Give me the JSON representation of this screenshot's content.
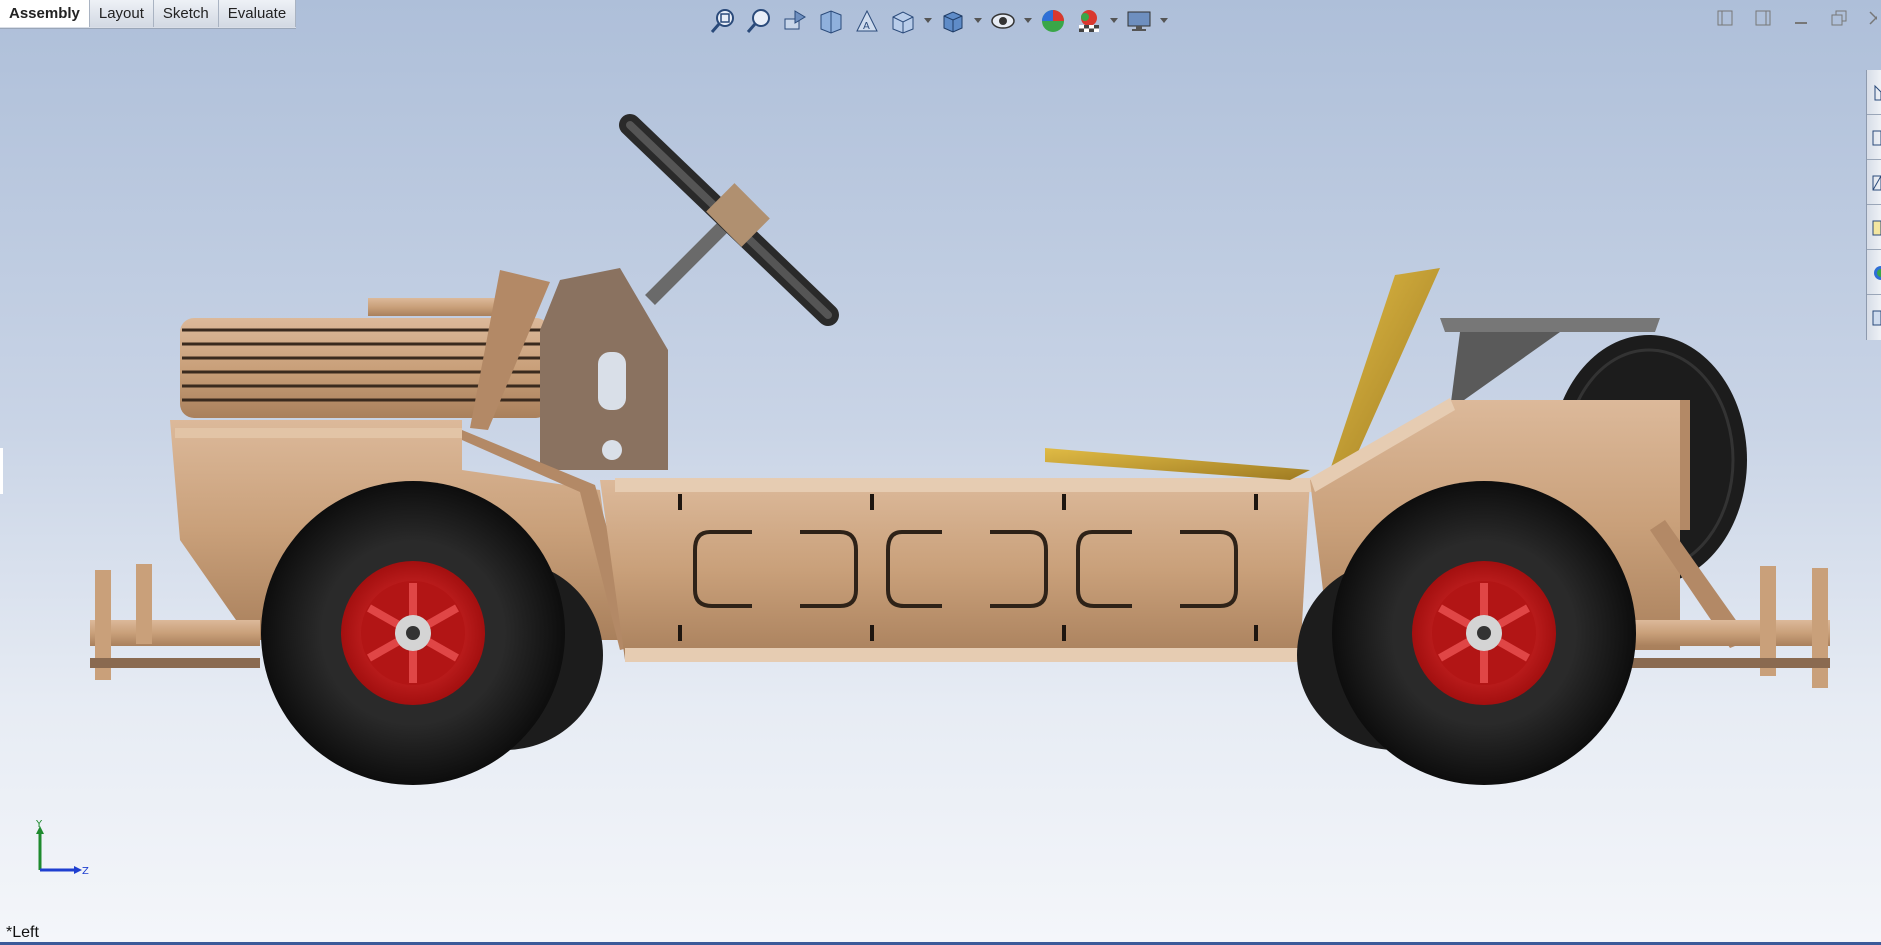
{
  "tabs": [
    {
      "label": "Assembly",
      "active": true
    },
    {
      "label": "Layout"
    },
    {
      "label": "Sketch"
    },
    {
      "label": "Evaluate"
    }
  ],
  "hud_toolbar": [
    "zoom-to-fit-icon",
    "zoom-to-area-icon",
    "previous-view-icon",
    "section-view-icon",
    "dynamic-annotation-icon",
    "view-orientation-icon",
    "display-style-icon",
    "hide-show-items-icon",
    "edit-appearance-icon",
    "apply-scene-icon",
    "view-settings-icon"
  ],
  "window_controls": [
    "tile-left-icon",
    "tile-right-icon",
    "minimize-icon",
    "restore-icon",
    "close-icon"
  ],
  "task_pane": [
    "home-icon",
    "design-library-icon",
    "file-explorer-icon",
    "view-palette-icon",
    "appearances-icon",
    "custom-properties-icon"
  ],
  "triad": {
    "y_label": "Y",
    "z_label": "Z"
  },
  "view_label": "*Left",
  "colors": {
    "wood": "#c9a07a",
    "tire": "#1e1e1e",
    "rim": "#cc1a1a",
    "seat": "#c9a23a"
  }
}
